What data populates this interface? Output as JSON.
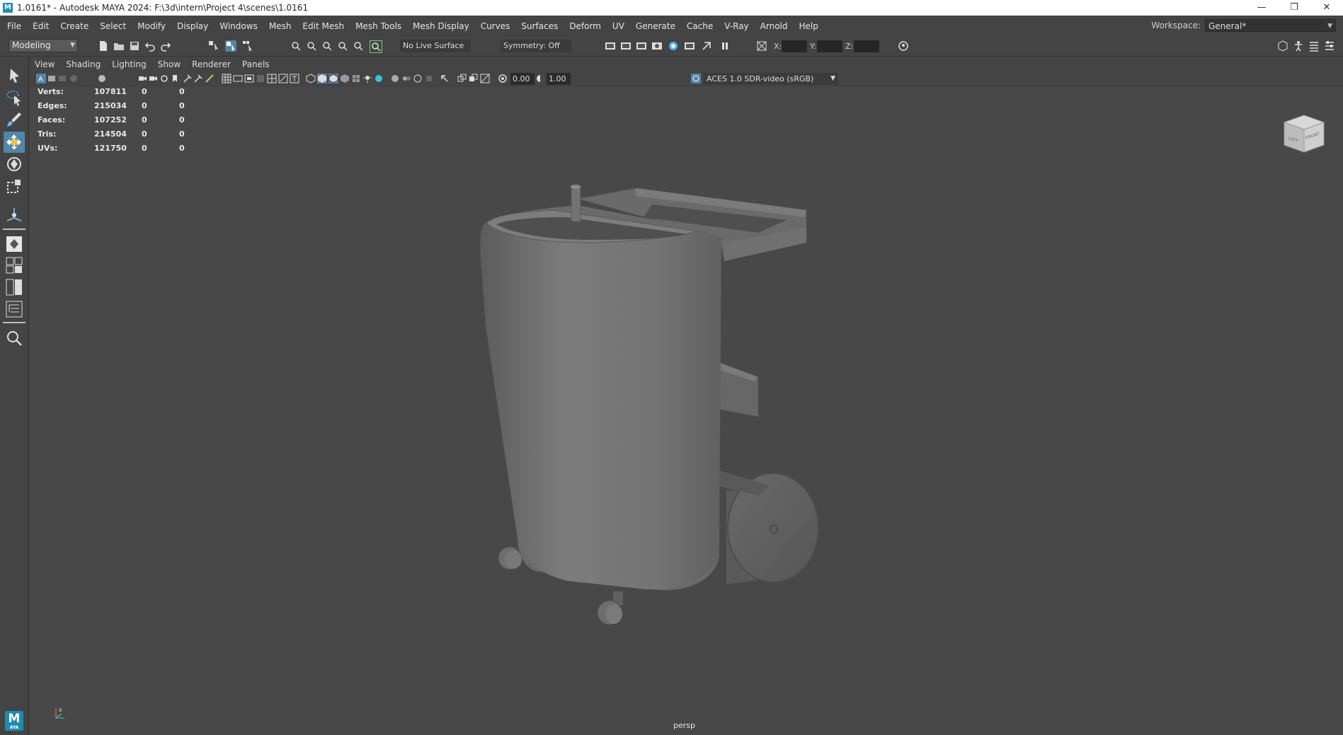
{
  "window": {
    "title": "1.0161* - Autodesk MAYA 2024: F:\\3d\\intern\\Project 4\\scenes\\1.0161",
    "app_icon_label": "M",
    "minimize": "—",
    "restore": "❐",
    "close": "✕"
  },
  "menubar": {
    "items": [
      "File",
      "Edit",
      "Create",
      "Select",
      "Modify",
      "Display",
      "Windows",
      "Mesh",
      "Edit Mesh",
      "Mesh Tools",
      "Mesh Display",
      "Curves",
      "Surfaces",
      "Deform",
      "UV",
      "Generate",
      "Cache",
      "V-Ray",
      "Arnold",
      "Help"
    ],
    "workspace_label": "Workspace:",
    "workspace_value": "General*"
  },
  "statusline": {
    "mode": "Modeling",
    "live_surface": "No Live Surface",
    "symmetry": "Symmetry: Off",
    "x_label": "X:",
    "y_label": "Y:",
    "z_label": "Z:"
  },
  "panel": {
    "menus": [
      "View",
      "Shading",
      "Lighting",
      "Show",
      "Renderer",
      "Panels"
    ],
    "exposure": "0.00",
    "gamma": "1.00",
    "color_space": "ACES 1.0 SDR-video (sRGB)"
  },
  "hud": {
    "rows": [
      {
        "label": "Verts:",
        "total": "107811",
        "sel": "0",
        "comp": "0"
      },
      {
        "label": "Edges:",
        "total": "215034",
        "sel": "0",
        "comp": "0"
      },
      {
        "label": "Faces:",
        "total": "107252",
        "sel": "0",
        "comp": "0"
      },
      {
        "label": "Tris:",
        "total": "214504",
        "sel": "0",
        "comp": "0"
      },
      {
        "label": "UVs:",
        "total": "121750",
        "sel": "0",
        "comp": "0"
      }
    ]
  },
  "viewcube": {
    "left": "LEFT",
    "front": "FRONT"
  },
  "camera": "persp",
  "toolbox": {
    "logo": "M",
    "logo_sub": "AYA"
  },
  "colors": {
    "active": "#5285a6",
    "background": "#444444",
    "viewport": "#484848",
    "model": "#6e6e6e"
  }
}
